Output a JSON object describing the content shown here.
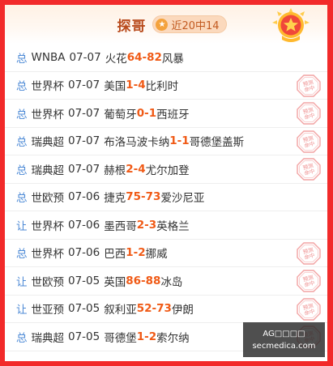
{
  "header": {
    "title": "探哥",
    "record": "近20中14"
  },
  "stamp_text": "预测命中",
  "rows": [
    {
      "type": "总",
      "league": "WNBA",
      "date": "07-07",
      "home": "火花",
      "home_score": "64",
      "away_score": "82",
      "away": "风暴",
      "hit": false
    },
    {
      "type": "总",
      "league": "世界杯",
      "date": "07-07",
      "home": "美国",
      "home_score": "1",
      "away_score": "4",
      "away": "比利时",
      "hit": true
    },
    {
      "type": "总",
      "league": "世界杯",
      "date": "07-07",
      "home": "葡萄牙",
      "home_score": "0",
      "away_score": "1",
      "away": "西班牙",
      "hit": true
    },
    {
      "type": "总",
      "league": "瑞典超",
      "date": "07-07",
      "home": "布洛马波卡纳",
      "home_score": "1",
      "away_score": "1",
      "away": "哥德堡盖斯",
      "hit": true
    },
    {
      "type": "总",
      "league": "瑞典超",
      "date": "07-07",
      "home": "赫根",
      "home_score": "2",
      "away_score": "4",
      "away": "尤尔加登",
      "hit": true
    },
    {
      "type": "总",
      "league": "世欧预",
      "date": "07-06",
      "home": "捷克",
      "home_score": "75",
      "away_score": "73",
      "away": "爱沙尼亚",
      "hit": false
    },
    {
      "type": "让",
      "league": "世界杯",
      "date": "07-06",
      "home": "墨西哥",
      "home_score": "2",
      "away_score": "3",
      "away": "英格兰",
      "hit": false
    },
    {
      "type": "总",
      "league": "世界杯",
      "date": "07-06",
      "home": "巴西",
      "home_score": "1",
      "away_score": "2",
      "away": "挪威",
      "hit": true
    },
    {
      "type": "让",
      "league": "世欧预",
      "date": "07-05",
      "home": "英国",
      "home_score": "86",
      "away_score": "88",
      "away": "冰岛",
      "hit": true
    },
    {
      "type": "让",
      "league": "世亚预",
      "date": "07-05",
      "home": "叙利亚",
      "home_score": "52",
      "away_score": "73",
      "away": "伊朗",
      "hit": true
    },
    {
      "type": "总",
      "league": "瑞典超",
      "date": "07-05",
      "home": "哥德堡",
      "home_score": "1",
      "away_score": "2",
      "away": "索尔纳",
      "hit": true
    }
  ],
  "watermark": {
    "line1": "AG□□□□",
    "line2": "secmedica.com"
  },
  "colors": {
    "frame": "#f22a2a",
    "score": "#f05a16",
    "type_label": "#4d8ad6",
    "title": "#b84a1c"
  }
}
